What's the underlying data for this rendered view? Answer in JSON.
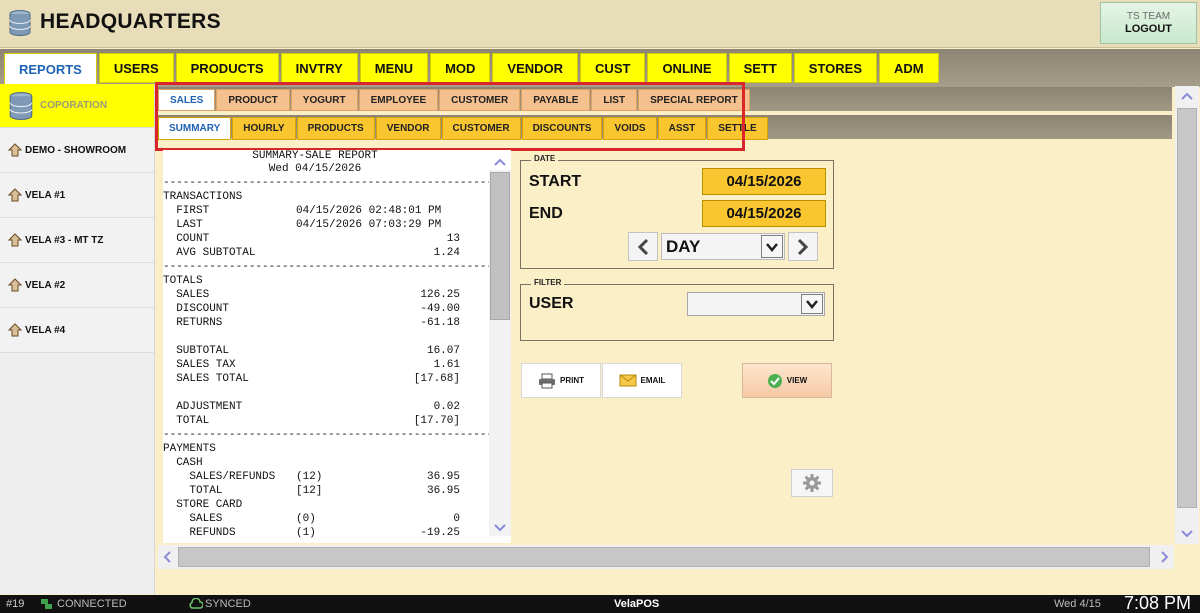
{
  "header": {
    "title": "HEADQUARTERS",
    "logo_icon": "database-stack-icon",
    "team": "TS TEAM",
    "logout_label": "LOGOUT"
  },
  "main_tabs": [
    {
      "label": "REPORTS",
      "active": true
    },
    {
      "label": "USERS"
    },
    {
      "label": "PRODUCTS"
    },
    {
      "label": "INVTRY"
    },
    {
      "label": "MENU"
    },
    {
      "label": "MOD"
    },
    {
      "label": "VENDOR"
    },
    {
      "label": "CUST"
    },
    {
      "label": "ONLINE"
    },
    {
      "label": "SETT"
    },
    {
      "label": "STORES"
    },
    {
      "label": "ADM"
    }
  ],
  "sidebar": {
    "items": [
      {
        "label": "COPORATION",
        "icon": "database-stack-icon",
        "active": true
      },
      {
        "label": "DEMO - SHOWROOM",
        "icon": "store-arrow-icon"
      },
      {
        "label": "VELA #1",
        "icon": "store-arrow-icon"
      },
      {
        "label": "VELA #3 - MT TZ",
        "icon": "store-arrow-icon"
      },
      {
        "label": "VELA #2",
        "icon": "store-arrow-icon"
      },
      {
        "label": "VELA #4",
        "icon": "store-arrow-icon"
      }
    ]
  },
  "report_tabs": [
    {
      "label": "SALES",
      "active": true
    },
    {
      "label": "PRODUCT"
    },
    {
      "label": "YOGURT"
    },
    {
      "label": "EMPLOYEE"
    },
    {
      "label": "CUSTOMER"
    },
    {
      "label": "PAYABLE"
    },
    {
      "label": "LIST"
    },
    {
      "label": "SPECIAL REPORT"
    }
  ],
  "sales_tabs": [
    {
      "label": "SUMMARY",
      "active": true
    },
    {
      "label": "HOURLY"
    },
    {
      "label": "PRODUCTS"
    },
    {
      "label": "VENDOR"
    },
    {
      "label": "CUSTOMER"
    },
    {
      "label": "DISCOUNTS"
    },
    {
      "label": "VOIDS"
    },
    {
      "label": "ASST"
    },
    {
      "label": "SETTLE"
    }
  ],
  "report": {
    "title": "SUMMARY-SALE REPORT",
    "date": "Wed 04/15/2026",
    "separator": "------------------------------------------------------",
    "lines": [
      {
        "sep": true
      },
      {
        "label": "TRANSACTIONS"
      },
      {
        "label": "  FIRST",
        "mid": "04/15/2026 02:48:01 PM"
      },
      {
        "label": "  LAST",
        "mid": "04/15/2026 07:03:29 PM"
      },
      {
        "label": "  COUNT",
        "value": "13"
      },
      {
        "label": "  AVG SUBTOTAL",
        "value": "1.24"
      },
      {
        "sep": true
      },
      {
        "label": "TOTALS"
      },
      {
        "label": "  SALES",
        "value": "126.25"
      },
      {
        "label": "  DISCOUNT",
        "value": "-49.00"
      },
      {
        "label": "  RETURNS",
        "value": "-61.18"
      },
      {
        "gap": true
      },
      {
        "label": "  SUBTOTAL",
        "value": "16.07"
      },
      {
        "label": "  SALES TAX",
        "value": "1.61"
      },
      {
        "label": "  SALES TOTAL",
        "value": "[17.68]"
      },
      {
        "gap": true
      },
      {
        "label": "  ADJUSTMENT",
        "value": "0.02"
      },
      {
        "label": "  TOTAL",
        "value": "[17.70]"
      },
      {
        "sep": true
      },
      {
        "label": "PAYMENTS"
      },
      {
        "label": "  CASH"
      },
      {
        "label": "    SALES/REFUNDS",
        "mid": "(12)",
        "value": "36.95"
      },
      {
        "label": "    TOTAL",
        "mid": "[12]",
        "value": "36.95"
      },
      {
        "label": "  STORE CARD"
      },
      {
        "label": "    SALES",
        "mid": "(0)",
        "value": "0"
      },
      {
        "label": "    REFUNDS",
        "mid": "(1)",
        "value": "-19.25"
      }
    ]
  },
  "date_panel": {
    "legend": "DATE",
    "start_label": "START",
    "start_value": "04/15/2026",
    "end_label": "END",
    "end_value": "04/15/2026",
    "period": "DAY"
  },
  "filter_panel": {
    "legend": "FILTER",
    "user_label": "USER",
    "user_value": ""
  },
  "actions": {
    "print": "PRINT",
    "email": "EMAIL",
    "view": "VIEW"
  },
  "status": {
    "number": "#19",
    "connection": "CONNECTED",
    "sync": "SYNCED",
    "brand": "VelaPOS",
    "date": "Wed 4/15",
    "time": "7:08 PM"
  },
  "colors": {
    "tab_yellow": "#ffff00",
    "report_tab_orange": "#f4c08e",
    "sales_tab_gold": "#f9c630",
    "active_blue": "#1f62b4",
    "highlight_red": "#d9262a",
    "content_bg": "#fbefc8"
  }
}
